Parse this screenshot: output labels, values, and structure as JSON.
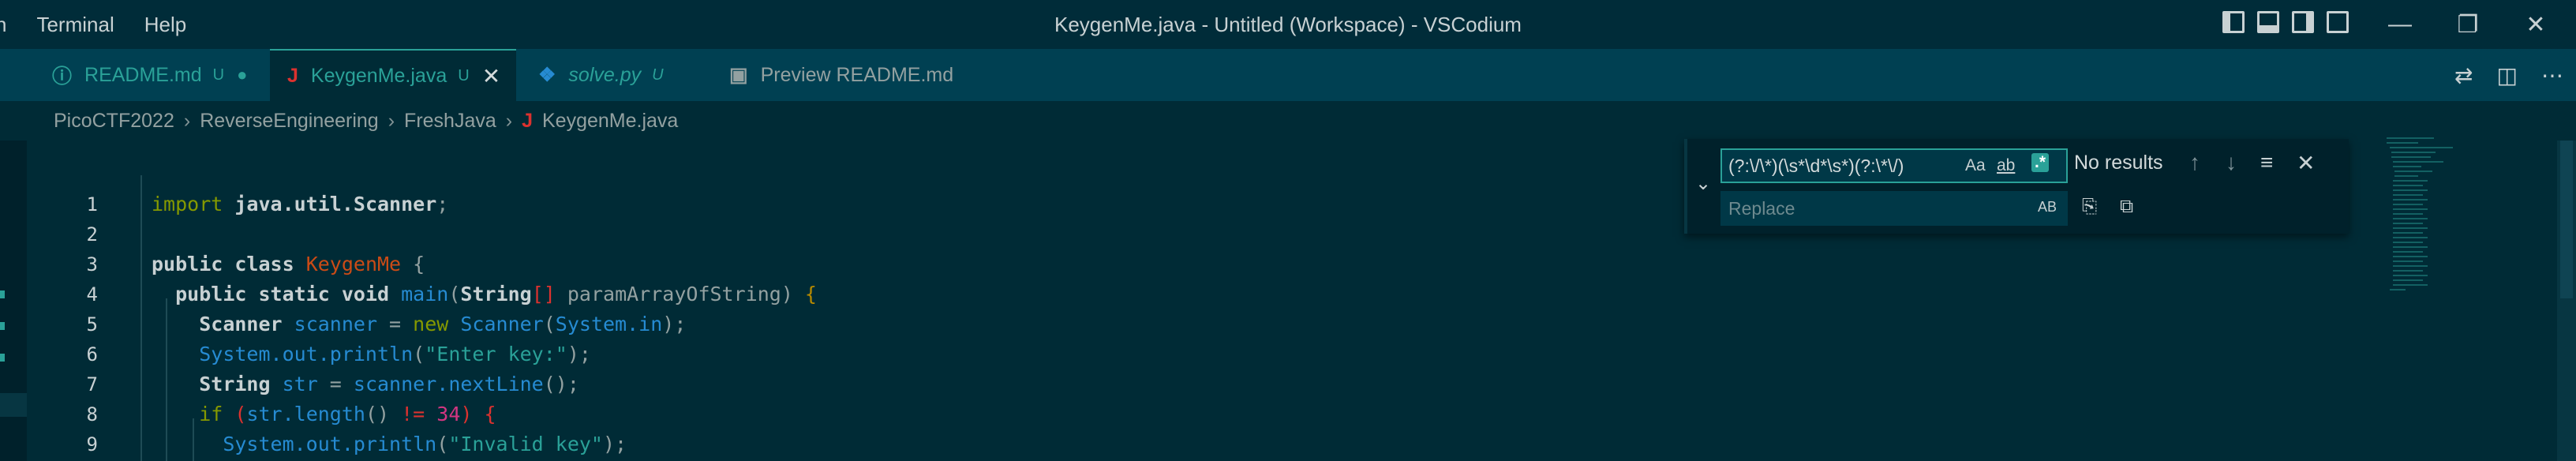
{
  "menu": {
    "items": [
      "n",
      "Terminal",
      "Help"
    ]
  },
  "window": {
    "title": "KeygenMe.java - Untitled (Workspace) - VSCodium"
  },
  "window_controls": {
    "minimize": "—",
    "restore": "❐",
    "close": "✕"
  },
  "tabs": [
    {
      "icon": "ⓘ",
      "label": "README.md",
      "status": "U",
      "end": "●"
    },
    {
      "icon": "J",
      "label": "KeygenMe.java",
      "status": "U",
      "end": "✕"
    },
    {
      "icon": "❖",
      "label": "solve.py",
      "status": "U",
      "end": ""
    },
    {
      "icon": "▣",
      "label": "Preview README.md",
      "status": "",
      "end": ""
    }
  ],
  "breadcrumb": [
    "PicoCTF2022",
    "ReverseEngineering",
    "FreshJava",
    "KeygenMe.java"
  ],
  "breadcrumb_file_icon": "J",
  "find": {
    "query": "(?:\\/\\*)(\\s*\\d*\\s*)(?:\\*\\/)",
    "replace_placeholder": "Replace",
    "match_case": "Aa",
    "whole_word": "ab",
    "regex": ".*",
    "results": "No results",
    "preserve_case": "AB"
  },
  "code": {
    "line_numbers": [
      "1",
      "2",
      "3",
      "4",
      "5",
      "6",
      "7",
      "8",
      "9"
    ]
  },
  "colors": {
    "background": "#002b36",
    "accent": "#2aa198",
    "keyword": "#859900",
    "string": "#2aa198",
    "number": "#d33682"
  }
}
